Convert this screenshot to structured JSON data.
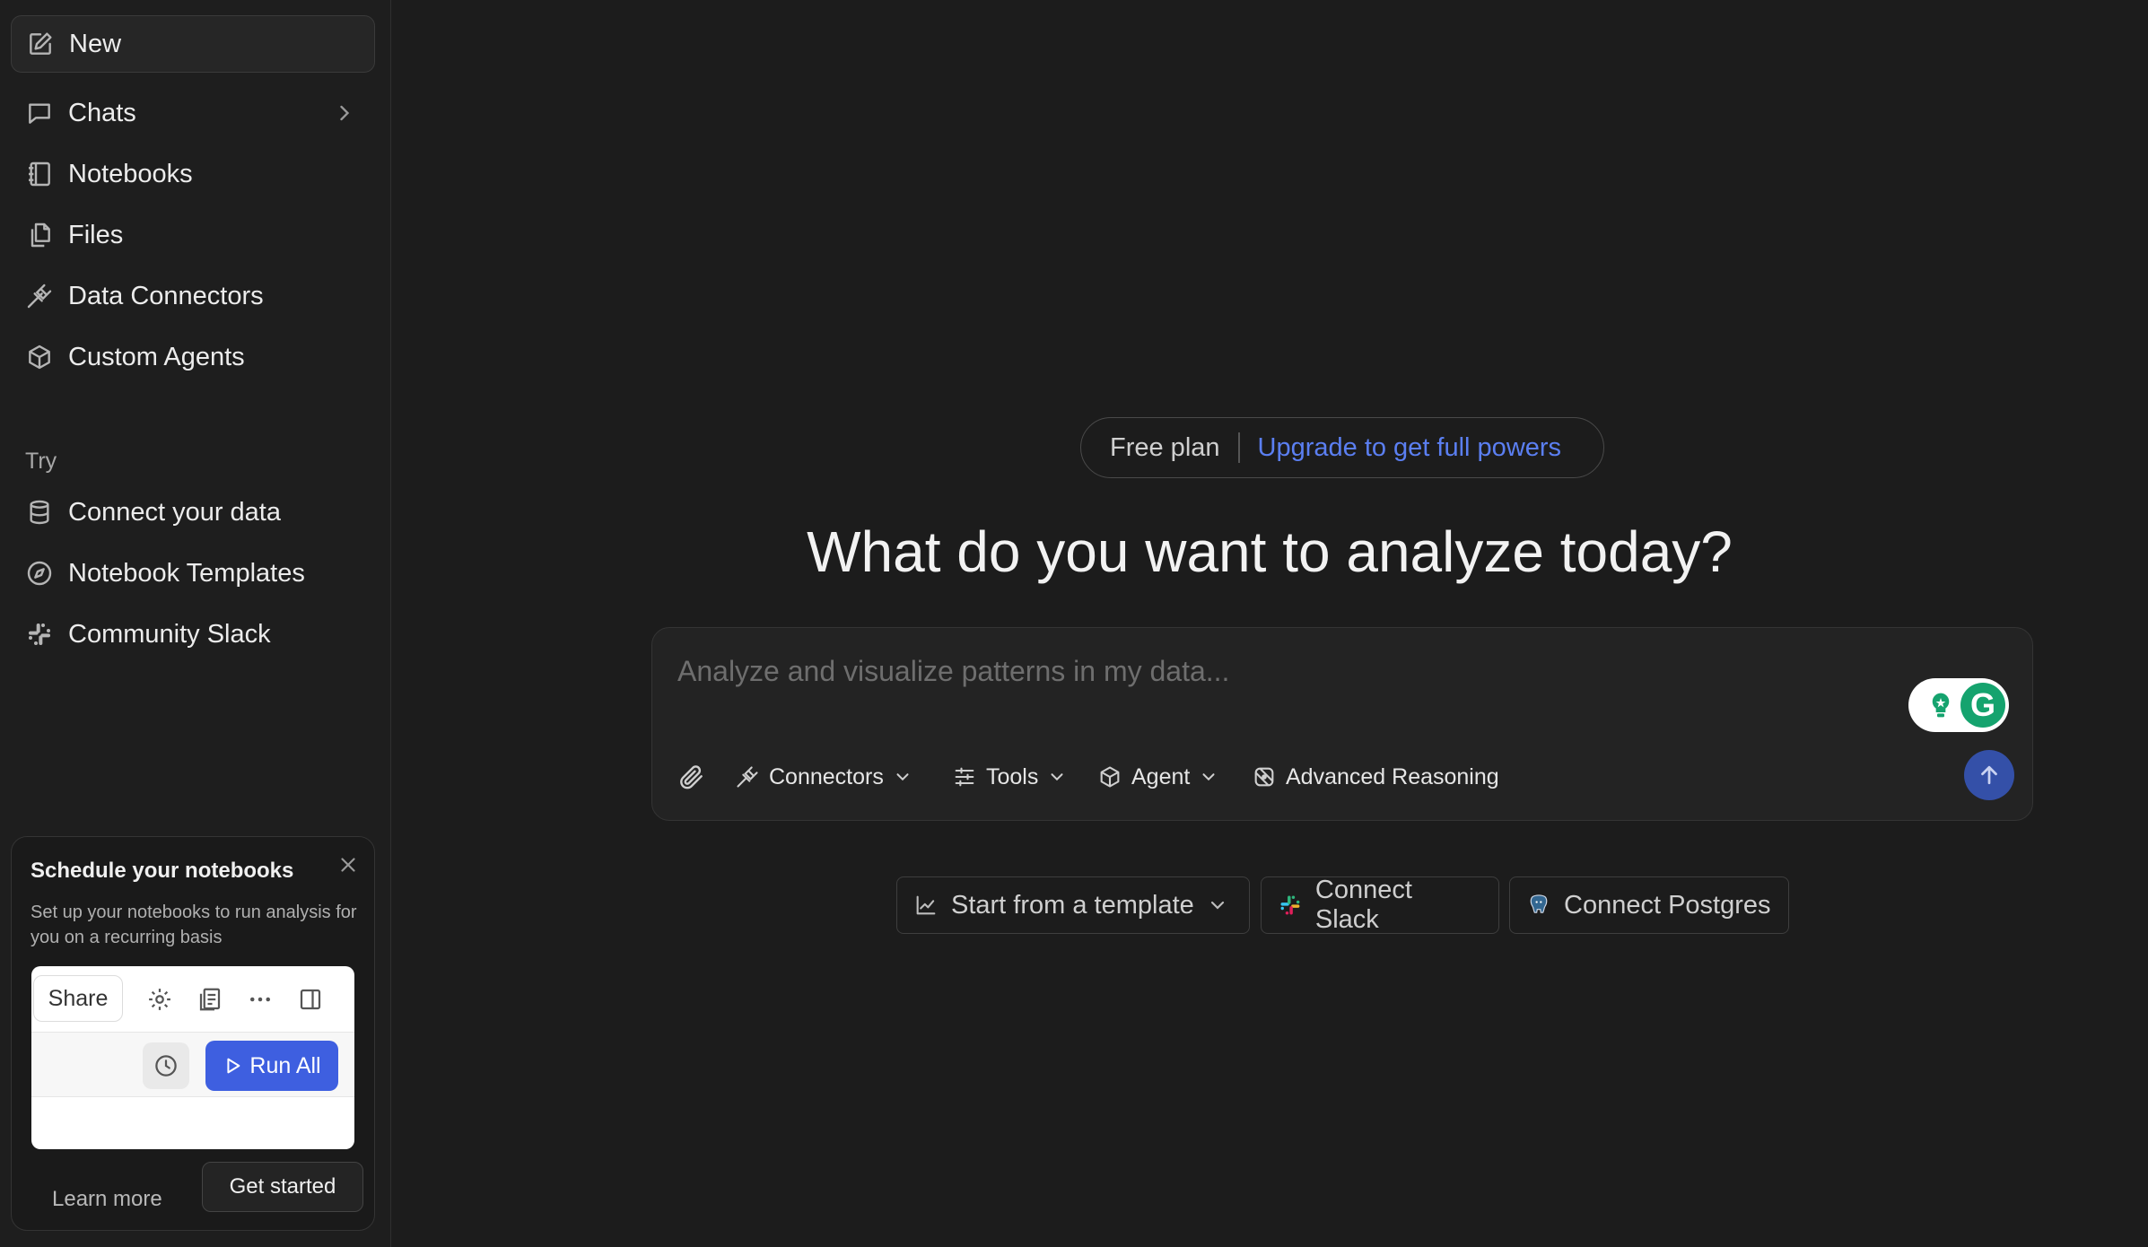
{
  "sidebar": {
    "new_label": "New",
    "items": [
      {
        "label": "Chats"
      },
      {
        "label": "Notebooks"
      },
      {
        "label": "Files"
      },
      {
        "label": "Data Connectors"
      },
      {
        "label": "Custom Agents"
      }
    ],
    "try_label": "Try",
    "try_items": [
      {
        "label": "Connect your data"
      },
      {
        "label": "Notebook Templates"
      },
      {
        "label": "Community Slack"
      }
    ]
  },
  "promo": {
    "title": "Schedule your notebooks",
    "description": "Set up your notebooks to run analysis for you on a recurring basis",
    "preview_share": "Share",
    "preview_run_all": "Run All",
    "learn_more": "Learn more",
    "get_started": "Get started"
  },
  "plan": {
    "free_label": "Free plan",
    "upgrade_label": "Upgrade to get full powers",
    "upgrade_color": "#5b7ff2"
  },
  "headline": "What do you want to analyze today?",
  "composer": {
    "placeholder": "Analyze and visualize patterns in my data...",
    "tools": {
      "connectors": "Connectors",
      "tools": "Tools",
      "agent": "Agent",
      "advanced_reasoning": "Advanced Reasoning"
    },
    "grammarly_letter": "G"
  },
  "chips": {
    "template": "Start from a template",
    "slack": "Connect Slack",
    "postgres": "Connect Postgres"
  },
  "colors": {
    "accent": "#3e5fe0",
    "send_button": "#3450a8",
    "background": "#1c1c1c"
  }
}
